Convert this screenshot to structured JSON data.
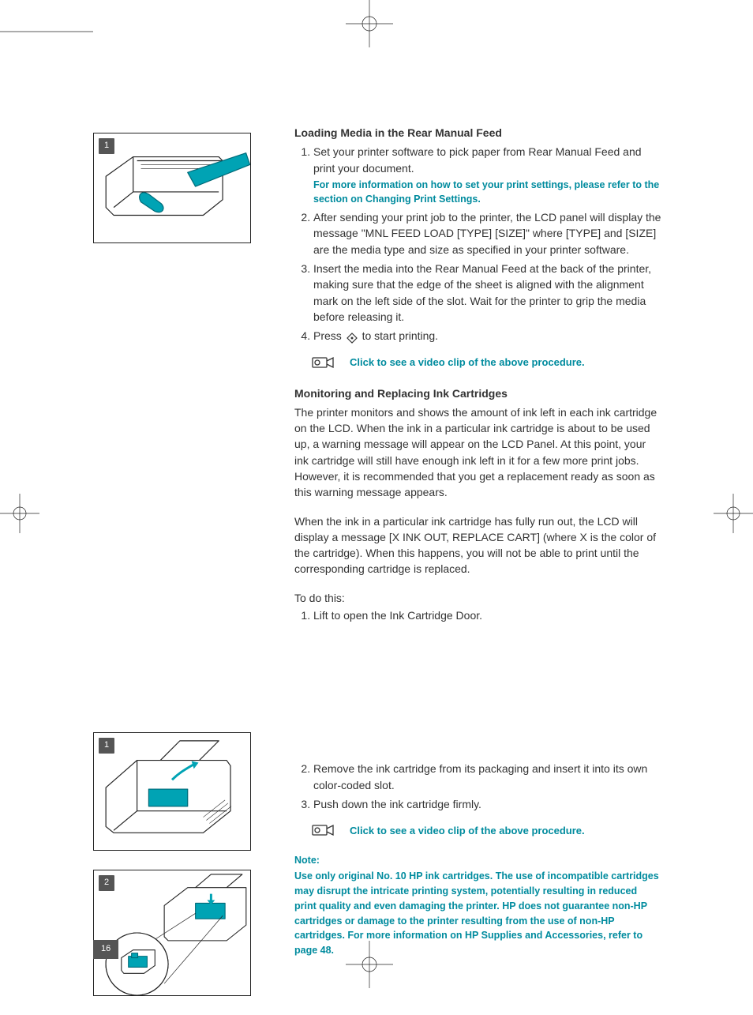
{
  "pageNumber": "16",
  "fig1Tag": "1",
  "fig2Tag": "1",
  "fig3Tag": "2",
  "section1": {
    "title": "Loading Media in the Rear Manual Feed",
    "step1": "Set your printer software to pick paper from Rear Manual Feed and print your document.",
    "step1_note": "For more information on how to set your print settings, please refer to the section on Changing Print Settings.",
    "step2": "After sending your print job to the printer, the LCD panel will display the message \"MNL FEED LOAD [TYPE] [SIZE]\" where [TYPE] and [SIZE] are the media type and size as specified in your printer software.",
    "step3": "Insert the media into the Rear Manual Feed at the back of the printer, making sure that the edge of the sheet is aligned with the alignment mark on the left side of the slot. Wait for the printer to grip the media before releasing it.",
    "step4_pre": "Press ",
    "step4_post": " to start printing.",
    "video": "Click to see a video clip of the above procedure."
  },
  "section2": {
    "title": "Monitoring and Replacing Ink Cartridges",
    "p1": "The printer monitors and shows the amount of ink left in each ink cartridge on the LCD. When the ink in a particular ink cartridge is about to be used up, a warning message will appear on the LCD Panel. At this point, your ink cartridge will still have enough ink left in it for a few more print jobs. However, it is recommended that you get a replacement ready as soon as this warning message appears.",
    "p2": "When the ink in a particular ink cartridge has fully run out, the LCD will display a message [X INK OUT, REPLACE CART] (where X is the color of the cartridge). When this happens, you will not be able to print until the corresponding cartridge is replaced.",
    "p3": "To do this:",
    "step1": "Lift to open the Ink Cartridge Door.",
    "step2": "Remove the ink cartridge from its packaging and insert it into its own color-coded slot.",
    "step3": "Push down the ink cartridge firmly.",
    "video": "Click to see a video clip of the above procedure."
  },
  "note": {
    "head": "Note:",
    "body": "Use only original No. 10 HP ink cartridges. The use of incompatible cartridges may disrupt the intricate printing system, potentially resulting in reduced print quality and even damaging the printer. HP does not guarantee non-HP cartridges or damage to the printer resulting from the use of non-HP cartridges. For more information on HP Supplies and Accessories, refer to page 48."
  }
}
